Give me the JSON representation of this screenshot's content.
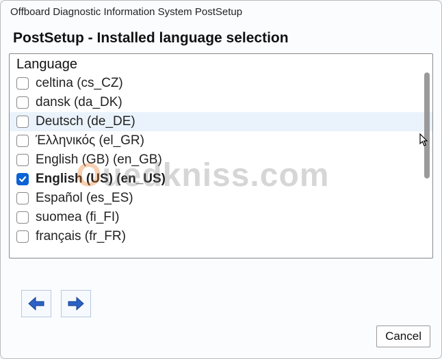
{
  "window": {
    "title": "Offboard Diagnostic Information System PostSetup"
  },
  "heading": "PostSetup - Installed language selection",
  "list": {
    "header": "Language",
    "items": [
      {
        "label": "celtina (cs_CZ)",
        "checked": false,
        "hover": false
      },
      {
        "label": "dansk (da_DK)",
        "checked": false,
        "hover": false
      },
      {
        "label": "Deutsch (de_DE)",
        "checked": false,
        "hover": true
      },
      {
        "label": "Έλληνικός (el_GR)",
        "checked": false,
        "hover": false
      },
      {
        "label": "English (GB) (en_GB)",
        "checked": false,
        "hover": false
      },
      {
        "label": "English (US)  (en_US)",
        "checked": true,
        "hover": false
      },
      {
        "label": "Español (es_ES)",
        "checked": false,
        "hover": false
      },
      {
        "label": "suomea (fi_FI)",
        "checked": false,
        "hover": false
      },
      {
        "label": "français (fr_FR)",
        "checked": false,
        "hover": false
      }
    ]
  },
  "buttons": {
    "cancel": "Cancel"
  },
  "watermark": {
    "lead": "O",
    "rest": "uedkniss.com"
  }
}
